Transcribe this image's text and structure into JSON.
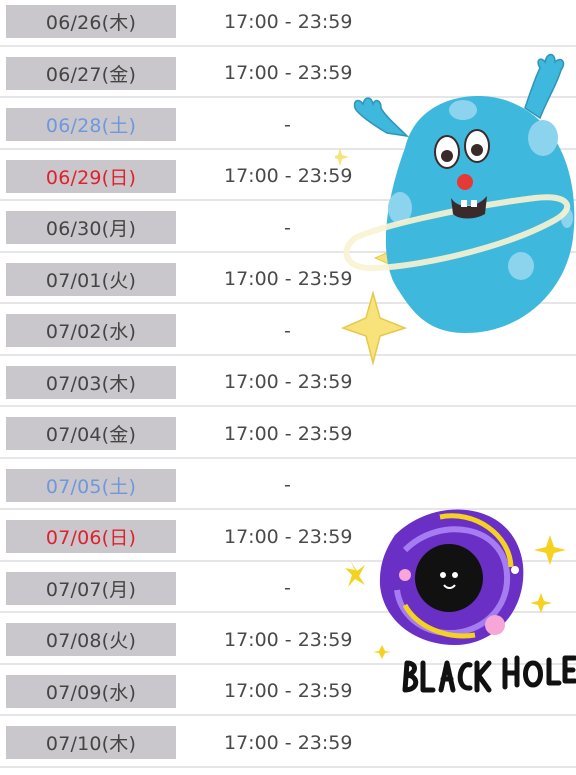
{
  "schedule": {
    "rows": [
      {
        "date": "06/26(木)",
        "day_type": "weekday",
        "time": "17:00 - 23:59"
      },
      {
        "date": "06/27(金)",
        "day_type": "weekday",
        "time": "17:00 - 23:59"
      },
      {
        "date": "06/28(土)",
        "day_type": "saturday",
        "time": "-"
      },
      {
        "date": "06/29(日)",
        "day_type": "sunday",
        "time": "17:00 - 23:59"
      },
      {
        "date": "06/30(月)",
        "day_type": "weekday",
        "time": "-"
      },
      {
        "date": "07/01(火)",
        "day_type": "weekday",
        "time": "17:00 - 23:59"
      },
      {
        "date": "07/02(水)",
        "day_type": "weekday",
        "time": "-"
      },
      {
        "date": "07/03(木)",
        "day_type": "weekday",
        "time": "17:00 - 23:59"
      },
      {
        "date": "07/04(金)",
        "day_type": "weekday",
        "time": "17:00 - 23:59"
      },
      {
        "date": "07/05(土)",
        "day_type": "saturday",
        "time": "-"
      },
      {
        "date": "07/06(日)",
        "day_type": "sunday",
        "time": "17:00 - 23:59"
      },
      {
        "date": "07/07(月)",
        "day_type": "weekday",
        "time": "-"
      },
      {
        "date": "07/08(火)",
        "day_type": "weekday",
        "time": "17:00 - 23:59"
      },
      {
        "date": "07/09(水)",
        "day_type": "weekday",
        "time": "17:00 - 23:59"
      },
      {
        "date": "07/10(木)",
        "day_type": "weekday",
        "time": "17:00 - 23:59"
      }
    ]
  },
  "stickers": {
    "monster": {
      "icon": "blue-monster-icon",
      "color": "#3fb8dd"
    },
    "black_hole": {
      "icon": "black-hole-icon",
      "text": "BLACK HOLE",
      "color": "#6a2fc4"
    }
  },
  "colors": {
    "date_cell_bg": "#c9c7cc",
    "saturday": "#6f97dc",
    "sunday": "#e0202c",
    "text": "#444444",
    "divider": "#e6e6e8"
  }
}
